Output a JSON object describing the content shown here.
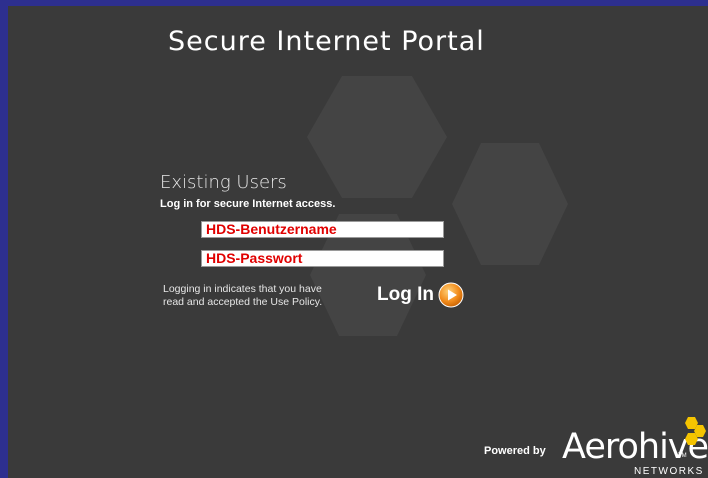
{
  "header": {
    "title": "Secure Internet Portal"
  },
  "login": {
    "heading": "Existing Users",
    "subheading": "Log in for secure Internet access.",
    "username_value": "HDS-Benutzername",
    "password_value": "HDS-Passwort",
    "policy_line1": "Logging in indicates that you have",
    "policy_line2": "read and accepted the Use Policy.",
    "button_label": "Log In"
  },
  "footer": {
    "powered_by": "Powered by",
    "brand_name": "Aerohive",
    "brand_tm": "TM",
    "brand_sub": "NETWORKS"
  },
  "colors": {
    "background": "#3a3a3a",
    "border": "#2d2f8f",
    "field_text": "#e00000",
    "accent": "#f28c1c",
    "brand_yellow": "#f5c400"
  },
  "icons": {
    "login_arrow": "play-circle-icon",
    "brand_mark": "hexagon-cluster-icon"
  }
}
